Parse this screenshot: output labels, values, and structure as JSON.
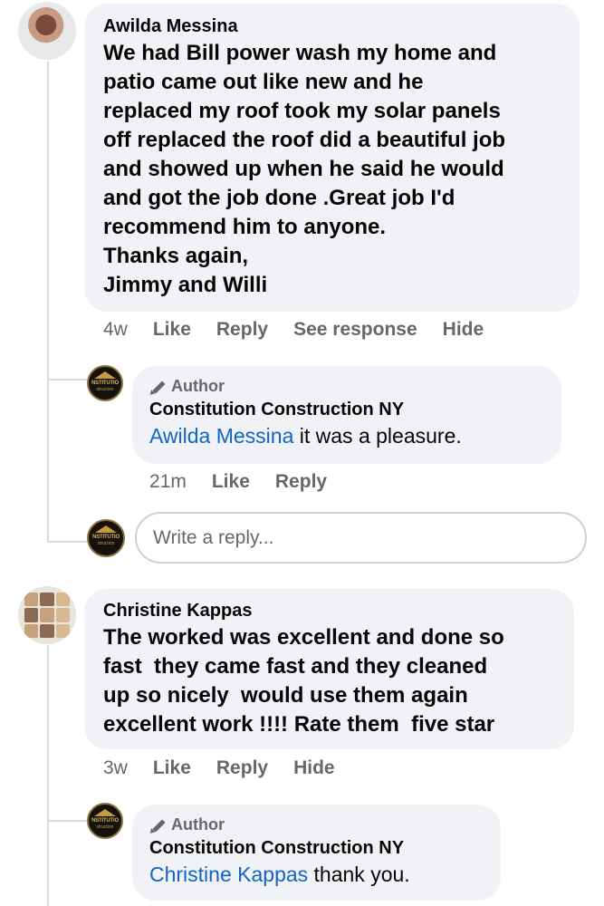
{
  "comments": [
    {
      "author": "Awilda Messina",
      "lines": [
        "We had Bill power wash my home and",
        "patio came out like new and he",
        "replaced my roof took my solar panels",
        "off replaced the roof did a beautiful job",
        "and showed up when he said he would",
        "and got the job done .Great job I'd",
        "recommend him to anyone.",
        "Thanks again,",
        "Jimmy and Willi"
      ],
      "time": "4w",
      "actions": [
        "Like",
        "Reply",
        "See response",
        "Hide"
      ],
      "reply": {
        "badge": "Author",
        "author": "Constitution Construction NY",
        "mention": "Awilda Messina",
        "text": " it was a pleasure.",
        "time": "21m",
        "actions": [
          "Like",
          "Reply"
        ]
      },
      "write_reply_placeholder": "Write a reply..."
    },
    {
      "author": "Christine Kappas",
      "lines": [
        "The worked was excellent and done so",
        "fast  they came fast and they cleaned",
        "up so nicely  would use them again",
        "excellent work !!!! Rate them  five star"
      ],
      "time": "3w",
      "actions": [
        "Like",
        "Reply",
        "Hide"
      ],
      "reply": {
        "badge": "Author",
        "author": "Constitution Construction NY",
        "mention": "Christine Kappas",
        "text": " thank you."
      }
    }
  ],
  "brand_logo": {
    "line1": "NSTITUTIO",
    "line2": "struction"
  },
  "colors": {
    "bubble": "#f0f2f5",
    "link": "#1264c5",
    "meta": "#65676b"
  }
}
